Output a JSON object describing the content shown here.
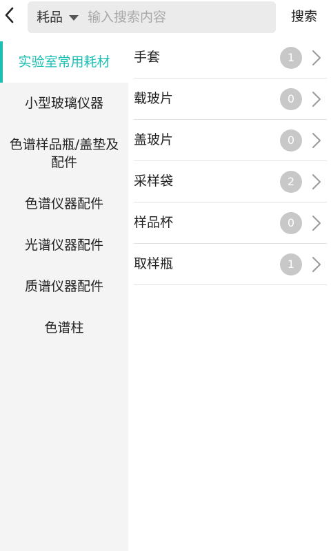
{
  "header": {
    "scope_label": "耗品",
    "search_placeholder": "输入搜索内容",
    "search_value": "",
    "search_button_label": "搜索"
  },
  "colors": {
    "accent": "#1cbfb4",
    "badge": "#c8c8c8",
    "sidebar_bg": "#f4f4f4"
  },
  "sidebar": {
    "items": [
      {
        "label": "实验室常用耗材",
        "active": true
      },
      {
        "label": "小型玻璃仪器",
        "active": false
      },
      {
        "label": "色谱样品瓶/盖垫及配件",
        "active": false
      },
      {
        "label": "色谱仪器配件",
        "active": false
      },
      {
        "label": "光谱仪器配件",
        "active": false
      },
      {
        "label": "质谱仪器配件",
        "active": false
      },
      {
        "label": "色谱柱",
        "active": false
      }
    ]
  },
  "list": {
    "items": [
      {
        "label": "手套",
        "count": "1"
      },
      {
        "label": "载玻片",
        "count": "0"
      },
      {
        "label": "盖玻片",
        "count": "0"
      },
      {
        "label": "采样袋",
        "count": "2"
      },
      {
        "label": "样品杯",
        "count": "0"
      },
      {
        "label": "取样瓶",
        "count": "1"
      }
    ]
  },
  "icons": {
    "back": "chevron-left-icon",
    "scope_caret": "caret-down-icon",
    "row_arrow": "chevron-right-icon"
  }
}
